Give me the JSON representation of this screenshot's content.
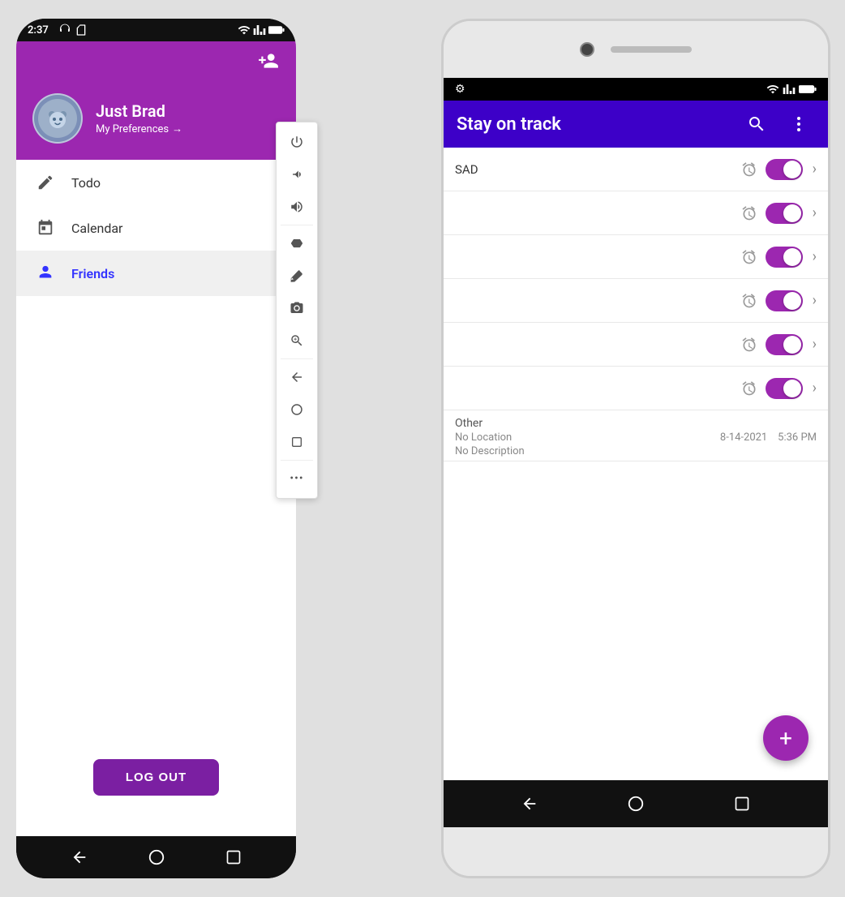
{
  "left_phone": {
    "status_bar": {
      "time": "2:37",
      "icons": [
        "headset",
        "sim"
      ]
    },
    "header": {
      "add_friend_icon": "person-add"
    },
    "profile": {
      "name": "Just Brad",
      "preferences_label": "My Preferences",
      "preferences_arrow": "→"
    },
    "nav_items": [
      {
        "id": "todo",
        "label": "Todo",
        "icon": "pencil",
        "active": false
      },
      {
        "id": "calendar",
        "label": "Calendar",
        "icon": "calendar",
        "active": false
      },
      {
        "id": "friends",
        "label": "Friends",
        "icon": "person",
        "active": true
      }
    ],
    "logout_label": "LOG OUT",
    "nav_bar": [
      "back",
      "circle",
      "square"
    ]
  },
  "right_phone": {
    "status_bar": {
      "gear_icon": "settings"
    },
    "header": {
      "title": "Stay on track",
      "search_icon": "search",
      "more_icon": "more-vert"
    },
    "list_items": [
      {
        "id": 1,
        "label": "SAD",
        "has_alarm": true,
        "toggle_on": true
      },
      {
        "id": 2,
        "label": "",
        "has_alarm": true,
        "toggle_on": true
      },
      {
        "id": 3,
        "label": "",
        "has_alarm": true,
        "toggle_on": true
      },
      {
        "id": 4,
        "label": "",
        "has_alarm": true,
        "toggle_on": true
      },
      {
        "id": 5,
        "label": "",
        "has_alarm": true,
        "toggle_on": true
      }
    ],
    "info_section": {
      "category": "Other",
      "location": "No Location",
      "date": "8-14-2021",
      "time": "5:36 PM",
      "description": "No Description",
      "has_alarm": true,
      "toggle_on": true
    },
    "fab_icon": "+",
    "nav_bar": [
      "back",
      "circle",
      "square"
    ]
  },
  "toolbar": {
    "items": [
      {
        "id": "power",
        "icon": "⏻"
      },
      {
        "id": "volume-down",
        "icon": "🔉"
      },
      {
        "id": "volume-up",
        "icon": "🔊"
      },
      {
        "id": "tag",
        "icon": "🏷"
      },
      {
        "id": "eraser",
        "icon": "⌫"
      },
      {
        "id": "camera",
        "icon": "📷"
      },
      {
        "id": "zoom",
        "icon": "🔍"
      },
      {
        "id": "back-arrow",
        "icon": "◁"
      },
      {
        "id": "circle",
        "icon": "○"
      },
      {
        "id": "square",
        "icon": "□"
      },
      {
        "id": "more",
        "icon": "···"
      }
    ]
  }
}
